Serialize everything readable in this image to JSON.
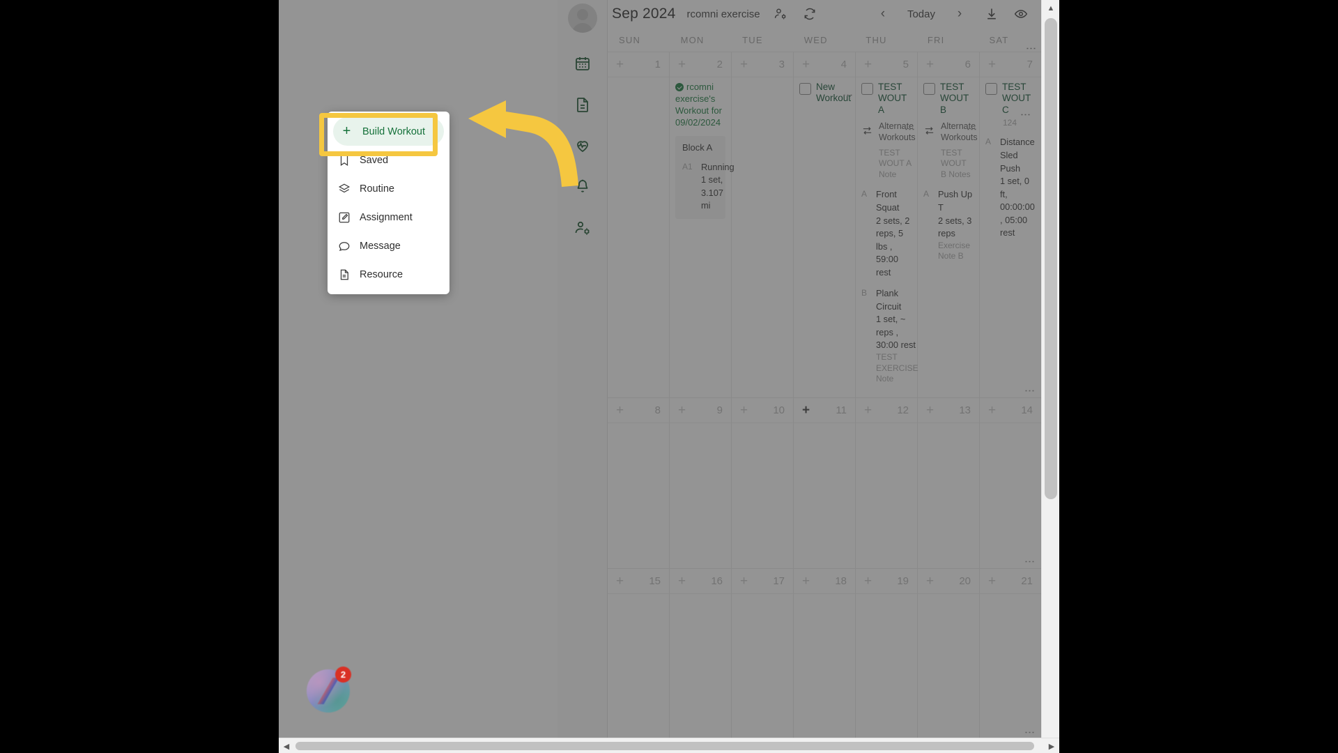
{
  "header": {
    "month_title": "Sep 2024",
    "client_name": "rcomni exercise",
    "manage_clients_icon": "user-settings-icon",
    "refresh_icon": "refresh-icon",
    "prev_label": "‹",
    "today_label": "Today",
    "next_label": "›",
    "download_icon": "download-icon",
    "visibility_icon": "eye-icon"
  },
  "sidebar": {
    "items": [
      {
        "icon": "calendar-icon",
        "name": "calendar"
      },
      {
        "icon": "document-icon",
        "name": "documents"
      },
      {
        "icon": "heart-pulse-icon",
        "name": "health"
      },
      {
        "icon": "bell-icon",
        "name": "notifications"
      },
      {
        "icon": "user-settings-icon",
        "name": "clients"
      }
    ]
  },
  "popup": {
    "items": [
      {
        "label": "Build Workout",
        "icon": "plus-icon",
        "highlighted": true
      },
      {
        "label": "Saved",
        "icon": "saved-icon",
        "highlighted": false
      },
      {
        "label": "Routine",
        "icon": "layers-icon",
        "highlighted": false
      },
      {
        "label": "Assignment",
        "icon": "edit-icon",
        "highlighted": false
      },
      {
        "label": "Message",
        "icon": "chat-icon",
        "highlighted": false
      },
      {
        "label": "Resource",
        "icon": "file-icon",
        "highlighted": false
      }
    ]
  },
  "calendar": {
    "weekdays": [
      "SUN",
      "MON",
      "TUE",
      "WED",
      "THU",
      "FRI",
      "SAT"
    ],
    "add_label": "+",
    "kebab_label": "⋮",
    "weeks": [
      {
        "days": [
          {
            "num": "1",
            "plus_active": false,
            "cards": []
          },
          {
            "num": "2",
            "plus_active": false,
            "cards": [
              {
                "type": "green",
                "title": "rcomni exercise's Workout for 09/02/2024",
                "block_name": "Block A",
                "exercises": [
                  {
                    "key": "A1",
                    "name": "Running",
                    "detail": "1 set, 3.107 mi"
                  }
                ]
              }
            ]
          },
          {
            "num": "3",
            "plus_active": false,
            "cards": []
          },
          {
            "num": "4",
            "plus_active": false,
            "cards": [
              {
                "type": "plain",
                "title": "New Workout",
                "checkbox": true,
                "kebab": true
              }
            ]
          },
          {
            "num": "5",
            "plus_active": false,
            "cards": [
              {
                "type": "full",
                "title": "TEST WOUT A",
                "checkbox": true,
                "kebab": true,
                "alternate_label": "Alternate Workouts",
                "note": "TEST WOUT A Note",
                "exercises": [
                  {
                    "key": "A",
                    "name": "Front Squat",
                    "detail": "2 sets, 2 reps, 5 lbs , 59:00 rest",
                    "note": ""
                  },
                  {
                    "key": "B",
                    "name": "Plank Circuit",
                    "detail": "1 set, ~ reps , 30:00 rest",
                    "note": "TEST EXERCISE Note"
                  }
                ]
              }
            ]
          },
          {
            "num": "6",
            "plus_active": false,
            "cards": [
              {
                "type": "full",
                "title": "TEST WOUT B",
                "checkbox": true,
                "kebab": true,
                "alternate_label": "Alternate Workouts",
                "note": "TEST WOUT B Notes",
                "exercises": [
                  {
                    "key": "A",
                    "name": "Push Up T",
                    "detail": "2 sets, 3 reps",
                    "note": "Exercise Note B"
                  }
                ]
              }
            ]
          },
          {
            "num": "7",
            "plus_active": false,
            "cards": [
              {
                "type": "full",
                "title": "TEST WOUT C",
                "checkbox": true,
                "kebab": true,
                "sub_meta": "124",
                "exercises": [
                  {
                    "key": "A",
                    "name": "Distance Sled Push",
                    "detail": "1 set, 0 ft, 00:00:00 , 05:00 rest",
                    "note": ""
                  }
                ]
              }
            ]
          }
        ]
      },
      {
        "days": [
          {
            "num": "8",
            "plus_active": false,
            "cards": []
          },
          {
            "num": "9",
            "plus_active": false,
            "cards": []
          },
          {
            "num": "10",
            "plus_active": false,
            "cards": []
          },
          {
            "num": "11",
            "plus_active": true,
            "cards": []
          },
          {
            "num": "12",
            "plus_active": false,
            "cards": []
          },
          {
            "num": "13",
            "plus_active": false,
            "cards": []
          },
          {
            "num": "14",
            "plus_active": false,
            "cards": []
          }
        ]
      },
      {
        "days": [
          {
            "num": "15",
            "plus_active": false,
            "cards": []
          },
          {
            "num": "16",
            "plus_active": false,
            "cards": []
          },
          {
            "num": "17",
            "plus_active": false,
            "cards": []
          },
          {
            "num": "18",
            "plus_active": false,
            "cards": []
          },
          {
            "num": "19",
            "plus_active": false,
            "cards": []
          },
          {
            "num": "20",
            "plus_active": false,
            "cards": []
          },
          {
            "num": "21",
            "plus_active": false,
            "cards": []
          }
        ]
      }
    ]
  },
  "app_badge": {
    "count": "2"
  },
  "annotation": {
    "highlight_color": "#f5c740",
    "arrow_color": "#f5c740",
    "target_label": "Build Workout"
  },
  "colors": {
    "brand_green": "#15713a",
    "accent_yellow": "#f5c740",
    "badge_red": "#d93025"
  },
  "scrollbars": {
    "up": "▲",
    "down": "▼",
    "left": "◀",
    "right": "▶"
  }
}
